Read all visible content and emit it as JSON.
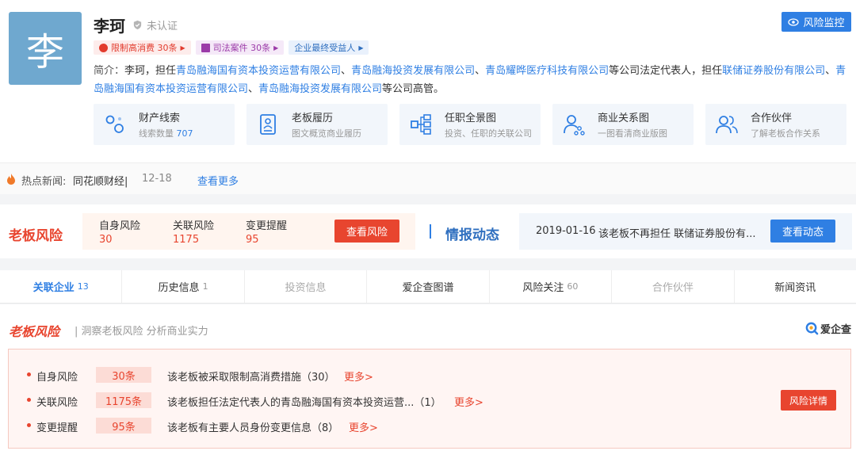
{
  "profile": {
    "avatar_char": "李",
    "name": "李珂",
    "verify_text": "未认证",
    "monitor_label": "风险监控",
    "tags": [
      {
        "label": "限制高消费 30条",
        "color": "red"
      },
      {
        "label": "司法案件 30条",
        "color": "purple"
      },
      {
        "label": "企业最终受益人",
        "color": "blue"
      }
    ],
    "intro": {
      "label": "简介：",
      "p1": "李珂，担任",
      "link1": "青岛融海国有资本投资运营有限公司",
      "sep1": "、",
      "link2": "青岛融海投资发展有限公司",
      "sep2": "、",
      "link3": "青岛耀晔医疗科技有限公司",
      "p2": "等公司法定代表人，担任",
      "link4": "联储证券股份有限公司",
      "sep3": "、",
      "link5": "青岛融海国有资本投资运营有限公司",
      "sep4": "、",
      "link6": "青岛融海投资发展有限公司",
      "p3": "等公司高管。"
    },
    "cards": [
      {
        "title": "财产线索",
        "sub": "线索数量",
        "num": "707",
        "icon": "property-icon"
      },
      {
        "title": "老板履历",
        "sub": "图文概览商业履历",
        "icon": "resume-icon"
      },
      {
        "title": "任职全景图",
        "sub": "投资、任职的关联公司",
        "icon": "org-chart-icon"
      },
      {
        "title": "商业关系图",
        "sub": "一图看清商业版图",
        "icon": "relation-icon"
      },
      {
        "title": "合作伙伴",
        "sub": "了解老板合作关系",
        "icon": "partners-icon"
      }
    ]
  },
  "news": {
    "label": "热点新闻:",
    "source": "同花顺财经|",
    "date": "12-18",
    "more": "查看更多"
  },
  "risk_bar": {
    "title": "老板风险",
    "items": [
      {
        "k": "自身风险",
        "v": "30"
      },
      {
        "k": "关联风险",
        "v": "1175"
      },
      {
        "k": "变更提醒",
        "v": "95"
      }
    ],
    "button": "查看风险"
  },
  "intel": {
    "title": "情报动态",
    "date": "2019-01-16",
    "text": "该老板不再担任 联储证券股份有...",
    "button": "查看动态"
  },
  "tabs": [
    {
      "label": "关联企业",
      "count": "13",
      "state": "active"
    },
    {
      "label": "历史信息",
      "count": "1",
      "state": "normal"
    },
    {
      "label": "投资信息",
      "count": "",
      "state": "disabled"
    },
    {
      "label": "爱企查图谱",
      "count": "",
      "state": "normal"
    },
    {
      "label": "风险关注",
      "count": "60",
      "state": "normal"
    },
    {
      "label": "合作伙伴",
      "count": "",
      "state": "disabled"
    },
    {
      "label": "新闻资讯",
      "count": "",
      "state": "normal"
    }
  ],
  "section": {
    "title": "老板风险",
    "subtitle": "| 洞察老板风险 分析商业实力",
    "brand": "爱企查",
    "rows": [
      {
        "label": "自身风险",
        "count": "30条",
        "text": "该老板被采取限制高消费措施（30）",
        "more": "更多>"
      },
      {
        "label": "关联风险",
        "count": "1175条",
        "text": "该老板担任法定代表人的青岛融海国有资本投资运营...（1）",
        "more": "更多>"
      },
      {
        "label": "变更提醒",
        "count": "95条",
        "text": "该老板有主要人员身份变更信息（8）",
        "more": "更多>"
      }
    ],
    "detail_button": "风险详情"
  },
  "colors": {
    "accent_blue": "#2f7fe3",
    "accent_red": "#e8452f",
    "avatar_bg": "#6fa8cf"
  }
}
